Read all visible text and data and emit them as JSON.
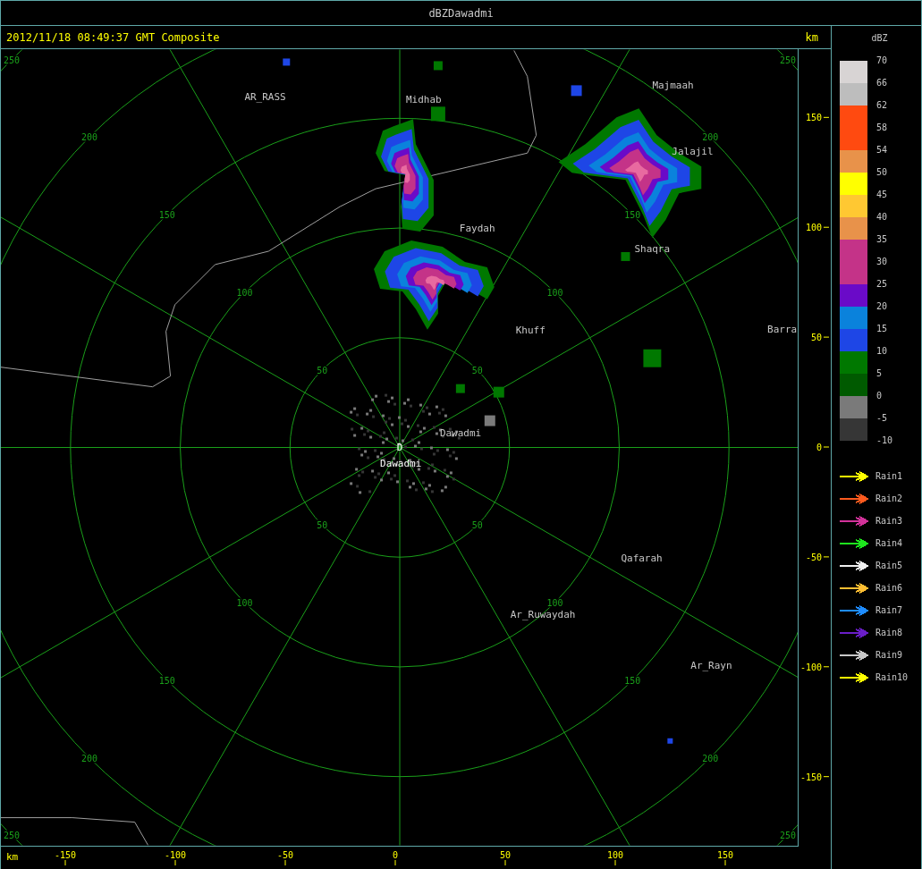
{
  "window": {
    "title": "dBZDawadmi"
  },
  "header": {
    "timestamp": "2012/11/18 08:49:37 GMT Composite",
    "unit": "km"
  },
  "radar": {
    "site_marker": "D",
    "range_rings": [
      {
        "labels": [
          "50",
          "50",
          "50",
          "50"
        ]
      },
      {
        "labels": [
          "100",
          "100",
          "100",
          "100"
        ]
      },
      {
        "labels": [
          "150",
          "150",
          "150",
          "150"
        ]
      },
      {
        "labels": [
          "200",
          "200",
          "200",
          "200"
        ]
      },
      {
        "labels": [
          "250",
          "250",
          "250",
          "250"
        ]
      }
    ],
    "places": [
      {
        "name": "AR_RASS"
      },
      {
        "name": "Midhab"
      },
      {
        "name": "Majmaah"
      },
      {
        "name": "Jalajil"
      },
      {
        "name": "Faydah"
      },
      {
        "name": "Shaqra"
      },
      {
        "name": "Barra"
      },
      {
        "name": "Khuff"
      },
      {
        "name": "Dawadmi"
      },
      {
        "name": "Dawadmi"
      },
      {
        "name": "Qafarah"
      },
      {
        "name": "Ar_Ruwaydah"
      },
      {
        "name": "Ar_Rayn"
      }
    ]
  },
  "y_axis": {
    "ticks": [
      "150",
      "100",
      "50",
      "0",
      "-50",
      "-100",
      "-150"
    ]
  },
  "x_axis": {
    "unit": "km",
    "ticks": [
      "-150",
      "-100",
      "-50",
      "0",
      "50",
      "100",
      "150"
    ]
  },
  "legend": {
    "title": "dBZ",
    "bins": [
      {
        "color": "#d8d4d4"
      },
      {
        "color": "#bdbdbd"
      },
      {
        "color": "#ff4a10"
      },
      {
        "color": "#ff4a10"
      },
      {
        "color": "#e8924a"
      },
      {
        "color": "#ffff00"
      },
      {
        "color": "#ffc832"
      },
      {
        "color": "#e8924a"
      },
      {
        "color": "#c43388"
      },
      {
        "color": "#c43388"
      },
      {
        "color": "#6a0ac8"
      },
      {
        "color": "#0a82dc"
      },
      {
        "color": "#1e46e6"
      },
      {
        "color": "#007800"
      },
      {
        "color": "#005a00"
      },
      {
        "color": "#7a7a7a"
      },
      {
        "color": "#363636"
      }
    ],
    "labels": [
      "70",
      "66",
      "62",
      "58",
      "54",
      "50",
      "45",
      "40",
      "35",
      "30",
      "25",
      "20",
      "15",
      "10",
      "5",
      "0",
      "-5",
      "-10"
    ]
  },
  "tracks": [
    {
      "label": "Rain1",
      "color": "#ffff00"
    },
    {
      "label": "Rain2",
      "color": "#ff5a1e"
    },
    {
      "label": "Rain3",
      "color": "#d2329a"
    },
    {
      "label": "Rain4",
      "color": "#1ee61e"
    },
    {
      "label": "Rain5",
      "color": "#f0f0f0"
    },
    {
      "label": "Rain6",
      "color": "#ffbe32"
    },
    {
      "label": "Rain7",
      "color": "#1e8cff"
    },
    {
      "label": "Rain8",
      "color": "#6a1ec8"
    },
    {
      "label": "Rain9",
      "color": "#c8c8c8"
    },
    {
      "label": "Rain10",
      "color": "#ffff00"
    }
  ]
}
